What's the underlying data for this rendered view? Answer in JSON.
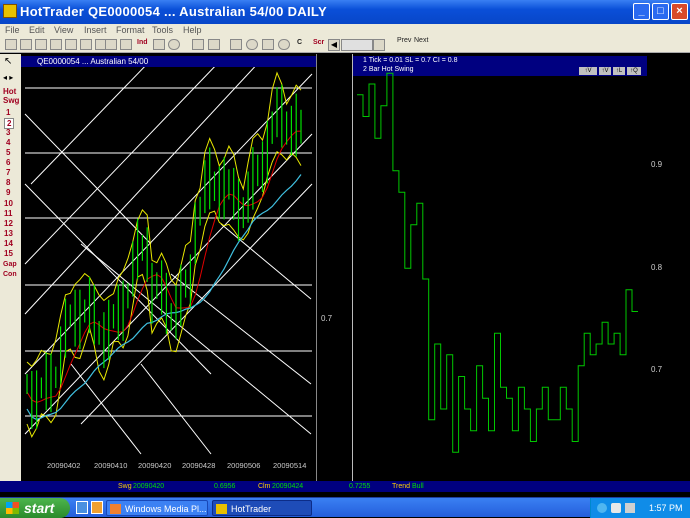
{
  "window": {
    "title": "HotTrader    QE0000054 ... Australian 54/00    DAILY"
  },
  "menu": [
    "File",
    "Edit",
    "View",
    "Insert",
    "Format",
    "Tools",
    "Help"
  ],
  "toolbar": {
    "ind_label": "Ind",
    "c_label": "C",
    "scr_label": "Scr",
    "prev_label": "Prev",
    "next_label": "Next"
  },
  "leftbar": {
    "hot": "Hot",
    "swg": "Swg",
    "numbers": [
      "1",
      "2",
      "3",
      "4",
      "5",
      "6",
      "7",
      "8",
      "9",
      "10",
      "11",
      "12",
      "13",
      "14",
      "15"
    ],
    "selected": "2",
    "gap": "Gap",
    "con": "Con"
  },
  "chart_left": {
    "header": "QE0000054 ... Australian 54/00",
    "y_label": "0.7",
    "x_labels": [
      "20090402",
      "20090410",
      "20090420",
      "20090428",
      "20090506",
      "20090514"
    ]
  },
  "chart_right": {
    "header_line1": "1 Tick = 0.01    SL = 0.7    CI = 0.8",
    "header_line2": "2  Bar Hot Swing",
    "buttons": [
      "↑V",
      "↑V",
      "↑L",
      "↑Q"
    ],
    "y_labels": [
      "0.9",
      "0.8",
      "0.7"
    ]
  },
  "status": {
    "swg_label": "Swg",
    "swg_date": "20090420",
    "swg_value": "0.6956",
    "clm_label": "Clm",
    "clm_date": "20090424",
    "clm_value": "0.7255",
    "trend_label": "Trend",
    "trend_value": "Bull"
  },
  "taskbar": {
    "start": "start",
    "media_player": "Windows Media Pl...",
    "hottrader": "HotTrader",
    "clock": "1:57 PM"
  },
  "colors": {
    "title_blue": "#0a4fd8",
    "bars_green": "#00e000",
    "band_yellow": "#e8e800",
    "ma_red": "#e00000",
    "ma_cyan": "#40c0e0",
    "swing_green": "#00c800"
  },
  "chart_data": [
    {
      "type": "bar",
      "title": "QE0000054 ... Australian 54/00",
      "x": [
        "20090402",
        "20090410",
        "20090420",
        "20090428",
        "20090506",
        "20090514"
      ],
      "ylabel": "",
      "series": [],
      "yticks": [
        0.7
      ]
    },
    {
      "type": "line",
      "title": "Bar Hot Swing",
      "yticks": [
        0.9,
        0.8,
        0.7
      ],
      "ylim": [
        0.6,
        0.96
      ],
      "series": [
        {
          "name": "Bar Hot Swing",
          "values": [
            0.95,
            0.93,
            0.96,
            0.91,
            0.94,
            0.97,
            0.88,
            0.86,
            0.79,
            0.83,
            0.85,
            0.78,
            0.65,
            0.72,
            0.66,
            0.71,
            0.62,
            0.69,
            0.66,
            0.64,
            0.7,
            0.67,
            0.64,
            0.73,
            0.68,
            0.67,
            0.64,
            0.68,
            0.66,
            0.63,
            0.66,
            0.68,
            0.65,
            0.65,
            0.68,
            0.66,
            0.63,
            0.7,
            0.73,
            0.71,
            0.72,
            0.74,
            0.72,
            0.73,
            0.71,
            0.77,
            0.75
          ]
        }
      ]
    }
  ]
}
